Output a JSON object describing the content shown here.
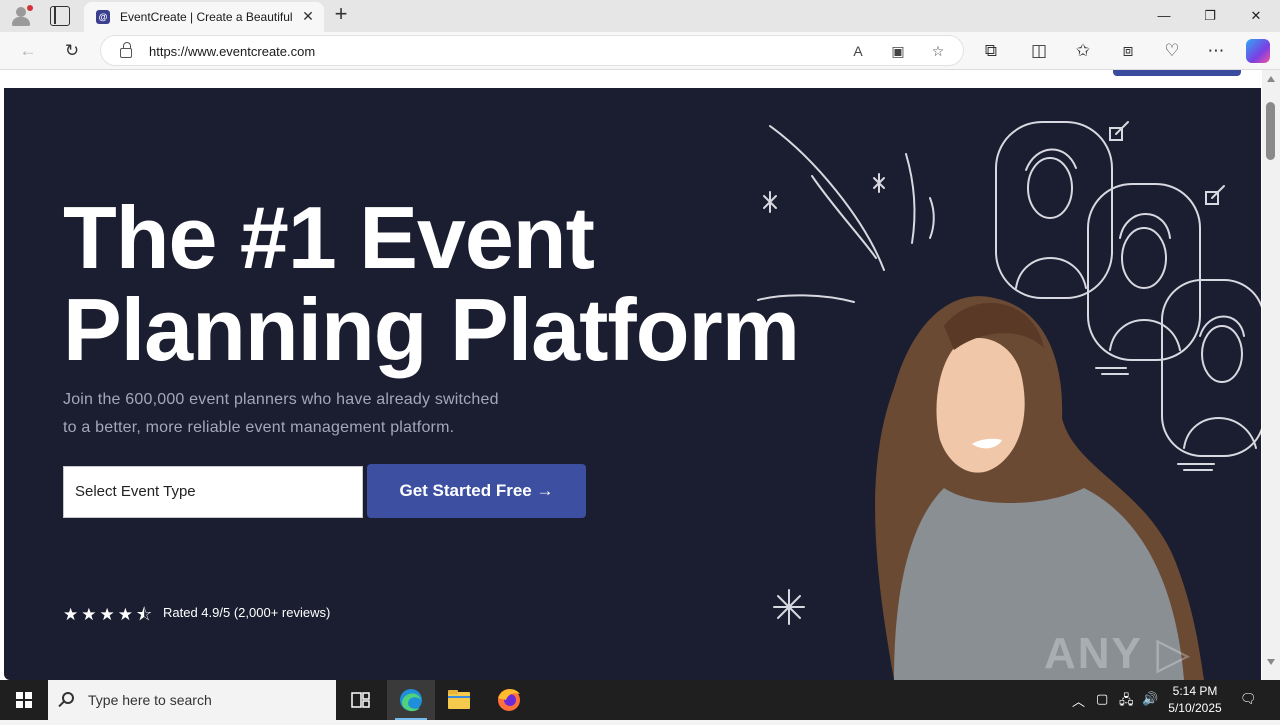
{
  "browser": {
    "tab_title": "EventCreate | Create a Beautiful E",
    "favicon_letter": "@",
    "url": "https://www.eventcreate.com"
  },
  "hero": {
    "headline_line1": "The #1 Event",
    "headline_line2": "Planning Platform",
    "subtext_line1": "Join the 600,000 event planners who have already switched",
    "subtext_line2": "to a better, more reliable event management platform.",
    "select_placeholder": "Select Event Type",
    "cta_label": "Get Started Free →",
    "rating_value": 4.5,
    "rating_max": 5,
    "rating_text": "Rated 4.9/5 (2,000+ reviews)",
    "stars_glyphs": "★★★★⯪"
  },
  "watermark": "ANY ▷ RUN",
  "taskbar": {
    "search_placeholder": "Type here to search",
    "time": "5:14 PM",
    "date": "5/10/2025"
  },
  "colors": {
    "hero_bg": "#1b1e30",
    "cta_bg": "#3d4fa1",
    "subtext": "#a4a7b8"
  },
  "icons": {
    "back": "arrow-left-icon",
    "refresh": "refresh-icon",
    "lock": "lock-icon",
    "read_aloud": "read-aloud-icon",
    "favorite": "star-icon",
    "extensions": "puzzle-icon",
    "split": "split-screen-icon",
    "favorites": "favorites-icon",
    "collections": "collections-icon",
    "more": "more-icon"
  }
}
